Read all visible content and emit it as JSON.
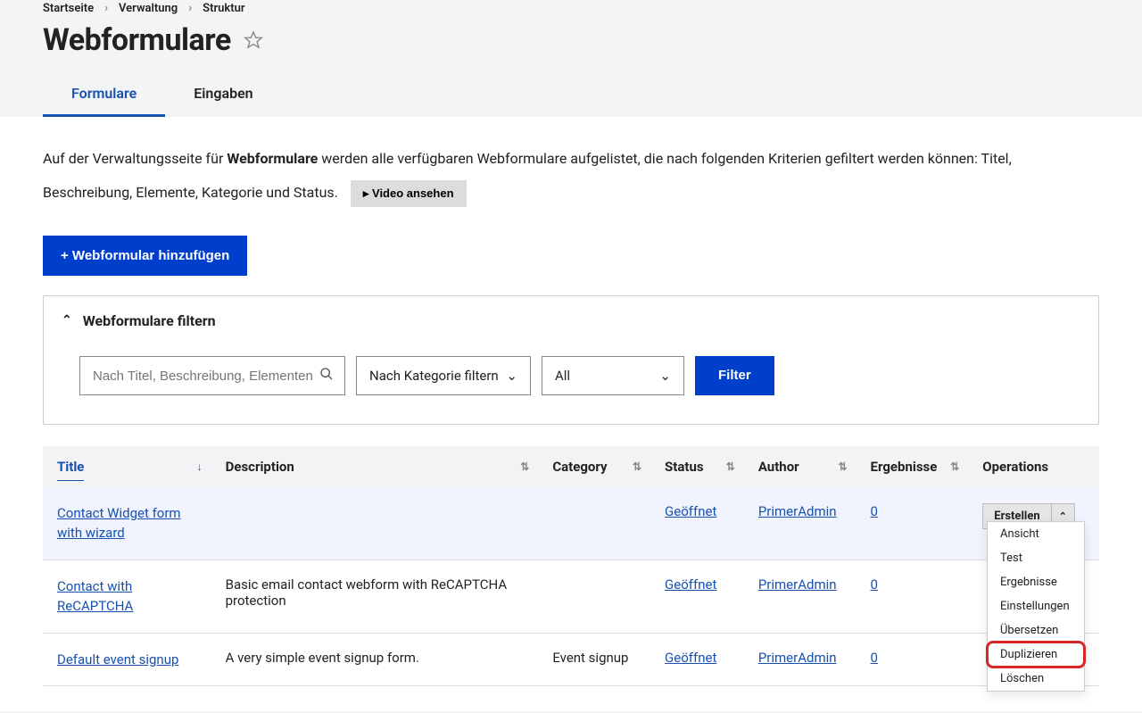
{
  "breadcrumb": {
    "home": "Startseite",
    "admin": "Verwaltung",
    "structure": "Struktur"
  },
  "page_title": "Webformulare",
  "tabs": {
    "forms": "Formulare",
    "submissions": "Eingaben"
  },
  "intro": {
    "pre": "Auf der Verwaltungsseite für ",
    "bold": "Webformulare",
    "post": " werden alle verfügbaren Webformulare aufgelistet, die nach folgenden Kriterien gefiltert werden können: Titel, Beschreibung, Elemente, Kategorie und Status."
  },
  "video_btn": "▸ Video ansehen",
  "add_btn": "+ Webformular hinzufügen",
  "filter": {
    "title": "Webformulare filtern",
    "search_placeholder": "Nach Titel, Beschreibung, Elementen",
    "category": "Nach Kategorie filtern",
    "status": "All",
    "apply": "Filter"
  },
  "columns": {
    "title": "Title",
    "description": "Description",
    "category": "Category",
    "status": "Status",
    "author": "Author",
    "results": "Ergebnisse",
    "operations": "Operations"
  },
  "rows": [
    {
      "title": "Contact Widget form with wizard",
      "description": "",
      "category": "",
      "status": "Geöffnet",
      "author": "PrimerAdmin",
      "results": "0"
    },
    {
      "title": "Contact with ReCAPTCHA",
      "description": "Basic email contact webform with ReCAPTCHA protection",
      "category": "",
      "status": "Geöffnet",
      "author": "PrimerAdmin",
      "results": "0"
    },
    {
      "title": "Default event signup",
      "description": "A very simple event signup form.",
      "category": "Event signup",
      "status": "Geöffnet",
      "author": "PrimerAdmin",
      "results": "0"
    }
  ],
  "ops_button": "Erstellen",
  "dropdown": {
    "view": "Ansicht",
    "test": "Test",
    "results": "Ergebnisse",
    "settings": "Einstellungen",
    "translate": "Übersetzen",
    "duplicate": "Duplizieren",
    "delete": "Löschen"
  }
}
